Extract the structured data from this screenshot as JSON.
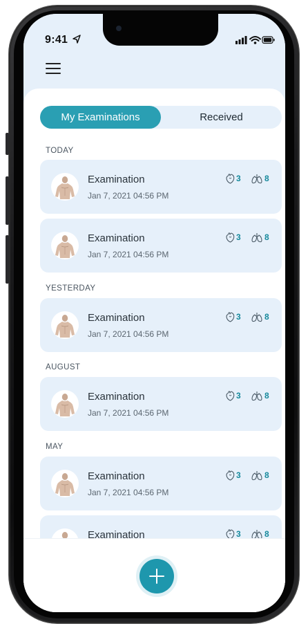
{
  "status_bar": {
    "time": "9:41"
  },
  "tabs": {
    "my_examinations": "My Examinations",
    "received": "Received"
  },
  "sections": [
    {
      "label": "TODAY",
      "items": [
        {
          "title": "Examination",
          "date": "Jan 7, 2021 04:56 PM",
          "heart_count": "3",
          "lung_count": "8"
        },
        {
          "title": "Examination",
          "date": "Jan 7, 2021 04:56 PM",
          "heart_count": "3",
          "lung_count": "8"
        }
      ]
    },
    {
      "label": "YESTERDAY",
      "items": [
        {
          "title": "Examination",
          "date": "Jan 7, 2021 04:56 PM",
          "heart_count": "3",
          "lung_count": "8"
        }
      ]
    },
    {
      "label": "AUGUST",
      "items": [
        {
          "title": "Examination",
          "date": "Jan 7, 2021 04:56 PM",
          "heart_count": "3",
          "lung_count": "8"
        }
      ]
    },
    {
      "label": "MAY",
      "items": [
        {
          "title": "Examination",
          "date": "Jan 7, 2021 04:56 PM",
          "heart_count": "3",
          "lung_count": "8"
        },
        {
          "title": "Examination",
          "date": "",
          "heart_count": "3",
          "lung_count": "8"
        }
      ]
    }
  ],
  "colors": {
    "accent": "#2a9fb3",
    "card_bg": "#e6f0fa",
    "metric": "#16899c"
  },
  "icons": {
    "menu": "hamburger-menu-icon",
    "heart": "heart-icon",
    "lungs": "lungs-icon",
    "add": "plus-icon"
  }
}
